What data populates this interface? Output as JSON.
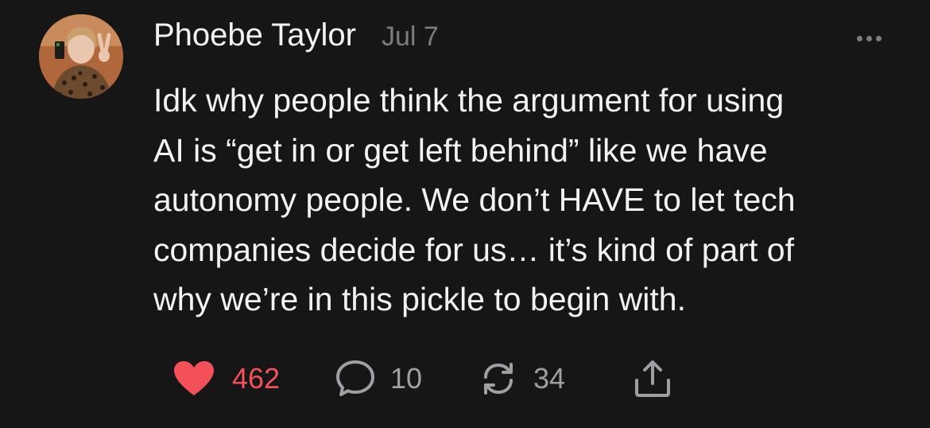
{
  "post": {
    "author": "Phoebe Taylor",
    "date": "Jul 7",
    "text_lines": [
      "Idk why people think the argument for using",
      "AI is “get in or get left behind” like we have",
      "autonomy people. We don’t HAVE to let tech",
      "companies decide for us… it’s kind of part of",
      "why we’re in this pickle to begin with."
    ],
    "more_icon": "ellipsis-icon"
  },
  "actions": {
    "like": {
      "icon": "heart-icon",
      "count": "462",
      "liked": true
    },
    "reply": {
      "icon": "speech-bubble-icon",
      "count": "10"
    },
    "repost": {
      "icon": "repost-icon",
      "count": "34"
    },
    "share": {
      "icon": "share-icon"
    }
  },
  "colors": {
    "background": "#161617",
    "text": "#f3f3f3",
    "muted": "#7c7c80",
    "like": "#f4505a"
  }
}
